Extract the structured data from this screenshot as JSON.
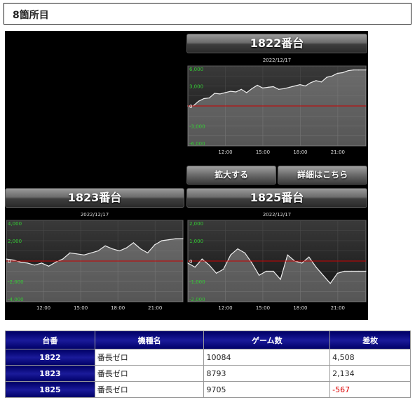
{
  "page": {
    "title": "8箇所目"
  },
  "buttons": {
    "zoom": "拡大する",
    "details": "詳細はこちら"
  },
  "chart_data": [
    {
      "type": "line",
      "title": "1822番台",
      "subtitle": "2022/12/17",
      "x_ticks": [
        "12:00",
        "15:00",
        "18:00",
        "21:00"
      ],
      "y_ticks": [
        "6,000",
        "3,000",
        "0",
        "-3,000",
        "-6,000"
      ],
      "ylim": [
        -6000,
        6000
      ],
      "series": [
        {
          "x": [
            0,
            0.03,
            0.06,
            0.09,
            0.12,
            0.15,
            0.18,
            0.21,
            0.24,
            0.27,
            0.3,
            0.33,
            0.36,
            0.39,
            0.42,
            0.45,
            0.48,
            0.51,
            0.54,
            0.57,
            0.6,
            0.63,
            0.66,
            0.69,
            0.72,
            0.75,
            0.78,
            0.81,
            0.84,
            0.87,
            0.9,
            0.93,
            0.96,
            1.0
          ],
          "values": [
            0,
            0,
            700,
            1100,
            1200,
            1900,
            1800,
            2000,
            2200,
            2100,
            2500,
            2000,
            2600,
            3100,
            2700,
            2800,
            2900,
            2500,
            2600,
            2800,
            3000,
            3200,
            3000,
            3500,
            3800,
            3600,
            4300,
            4500,
            4900,
            5000,
            5300,
            5400,
            5400,
            5400
          ]
        }
      ],
      "grid": true
    },
    {
      "type": "line",
      "title": "1823番台",
      "subtitle": "2022/12/17",
      "x_ticks": [
        "12:00",
        "15:00",
        "18:00",
        "21:00"
      ],
      "y_ticks": [
        "4,000",
        "2,000",
        "0",
        "-2,000",
        "-4,000"
      ],
      "ylim": [
        -4000,
        4000
      ],
      "series": [
        {
          "x": [
            0,
            0.04,
            0.08,
            0.12,
            0.16,
            0.2,
            0.24,
            0.28,
            0.32,
            0.36,
            0.4,
            0.44,
            0.48,
            0.52,
            0.56,
            0.6,
            0.64,
            0.68,
            0.72,
            0.76,
            0.8,
            0.84,
            0.88,
            0.92,
            0.96,
            1.0
          ],
          "values": [
            200,
            100,
            -100,
            -200,
            -400,
            -200,
            -500,
            -100,
            200,
            800,
            700,
            600,
            800,
            1000,
            1500,
            1200,
            1000,
            1300,
            1800,
            1200,
            800,
            1600,
            2000,
            2100,
            2200,
            2200
          ]
        }
      ],
      "grid": true
    },
    {
      "type": "line",
      "title": "1825番台",
      "subtitle": "2022/12/17",
      "x_ticks": [
        "12:00",
        "15:00",
        "18:00",
        "21:00"
      ],
      "y_ticks": [
        "2,000",
        "1,000",
        "0",
        "-1,000",
        "-2,000"
      ],
      "ylim": [
        -2000,
        2000
      ],
      "series": [
        {
          "x": [
            0,
            0.04,
            0.08,
            0.12,
            0.16,
            0.2,
            0.24,
            0.28,
            0.32,
            0.36,
            0.4,
            0.44,
            0.48,
            0.52,
            0.56,
            0.6,
            0.64,
            0.68,
            0.72,
            0.76,
            0.8,
            0.84,
            0.88,
            0.92,
            0.96,
            1.0
          ],
          "values": [
            -100,
            -300,
            100,
            -200,
            -600,
            -400,
            300,
            600,
            400,
            -100,
            -700,
            -500,
            -500,
            -900,
            300,
            0,
            -100,
            200,
            -300,
            -700,
            -1100,
            -600,
            -500,
            -500,
            -500,
            -500
          ]
        }
      ],
      "grid": true
    }
  ],
  "table": {
    "headers": [
      "台番",
      "機種名",
      "ゲーム数",
      "差枚"
    ],
    "rows": [
      [
        "1822",
        "番長ゼロ",
        "10084",
        "4,508"
      ],
      [
        "1823",
        "番長ゼロ",
        "8793",
        "2,134"
      ],
      [
        "1825",
        "番長ゼロ",
        "9705",
        "-567"
      ]
    ]
  },
  "colors": {
    "zero_line": "#cc0000",
    "axis_label": "#33cc33",
    "header_bg": "#000066",
    "negative": "#dd0000"
  }
}
